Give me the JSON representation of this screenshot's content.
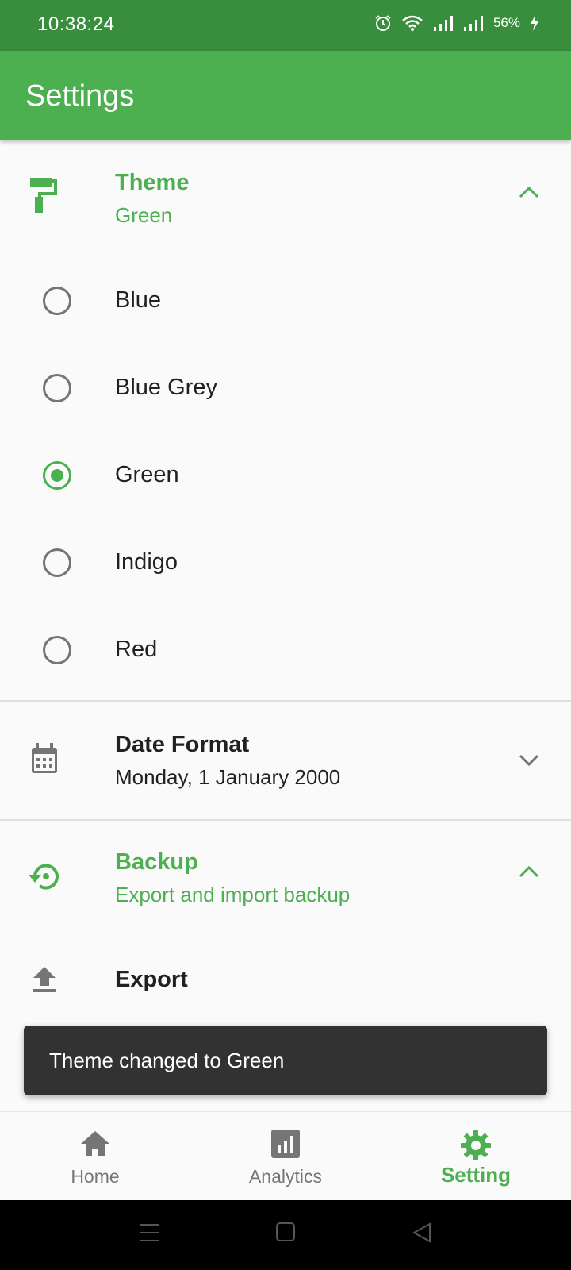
{
  "status": {
    "time": "10:38:24",
    "battery": "56%"
  },
  "appbar": {
    "title": "Settings"
  },
  "theme": {
    "title": "Theme",
    "subtitle": "Green",
    "options": [
      {
        "label": "Blue",
        "selected": false
      },
      {
        "label": "Blue Grey",
        "selected": false
      },
      {
        "label": "Green",
        "selected": true
      },
      {
        "label": "Indigo",
        "selected": false
      },
      {
        "label": "Red",
        "selected": false
      }
    ]
  },
  "date_format": {
    "title": "Date Format",
    "subtitle": "Monday, 1 January 2000"
  },
  "backup": {
    "title": "Backup",
    "subtitle": "Export and import backup",
    "export_label": "Export"
  },
  "snackbar": {
    "text": "Theme changed to Green"
  },
  "bottom_nav": {
    "home": "Home",
    "analytics": "Analytics",
    "setting": "Setting"
  },
  "colors": {
    "primary": "#4caf50",
    "primary_dark": "#388e3c",
    "snackbar": "#323232"
  },
  "icons": {
    "theme": "paint-roller-icon",
    "date": "calendar-icon",
    "backup": "restore-icon",
    "export": "upload-icon",
    "home": "home-icon",
    "analytics": "chart-icon",
    "setting": "gear-icon"
  }
}
